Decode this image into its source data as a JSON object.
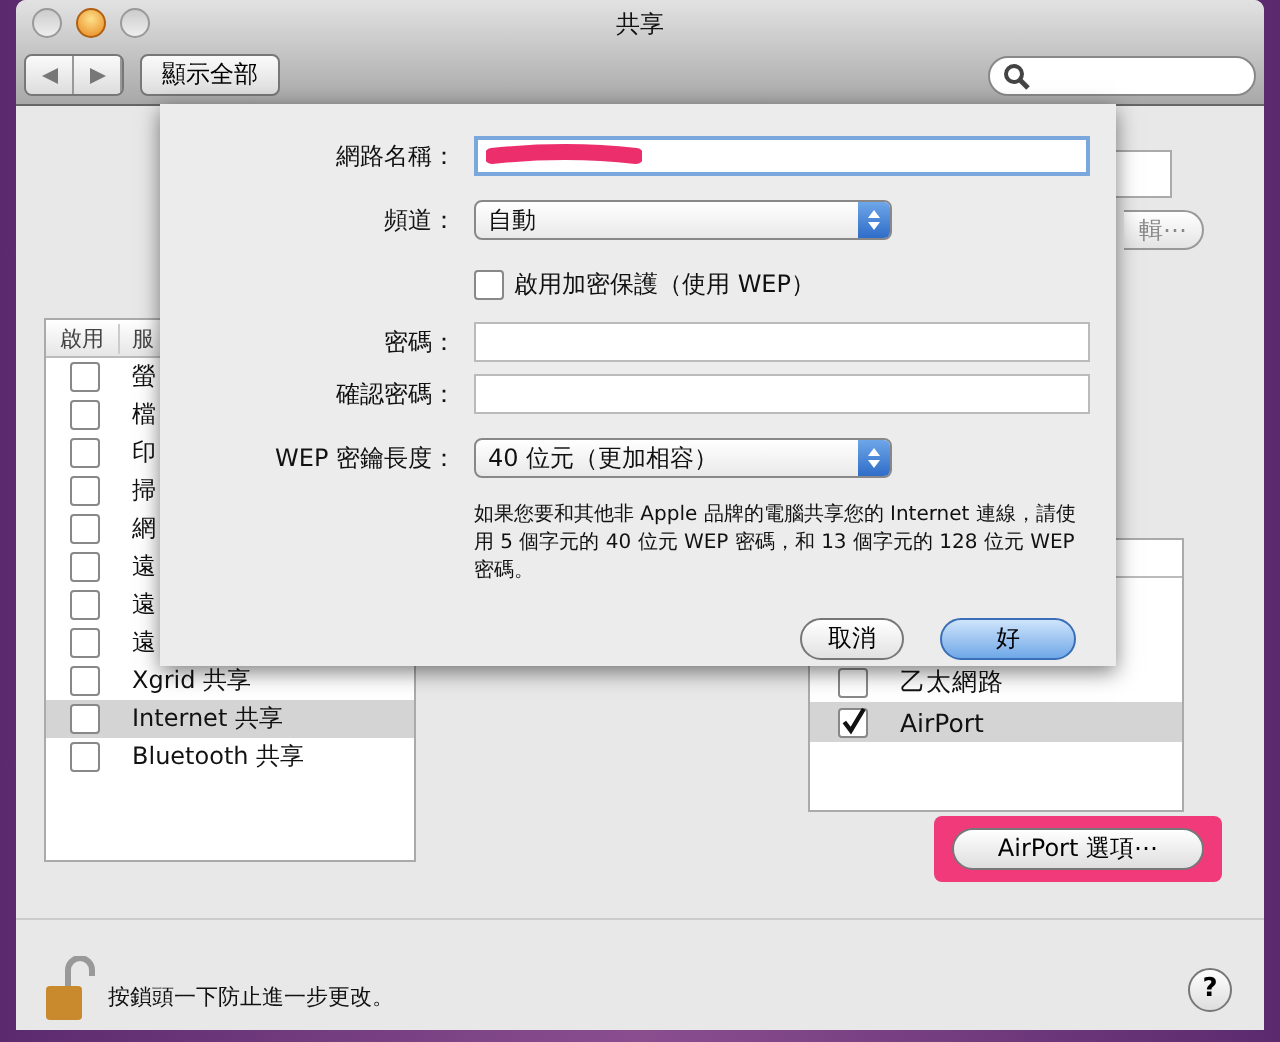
{
  "window": {
    "title": "共享"
  },
  "toolbar": {
    "show_all": "顯示全部"
  },
  "edit_button": "輯⋯",
  "services": {
    "columns": [
      "啟用",
      "服"
    ],
    "items": [
      {
        "name": "螢",
        "checked": false,
        "selected": false
      },
      {
        "name": "檔",
        "checked": false,
        "selected": false
      },
      {
        "name": "印",
        "checked": false,
        "selected": false
      },
      {
        "name": "掃",
        "checked": false,
        "selected": false
      },
      {
        "name": "網",
        "checked": false,
        "selected": false
      },
      {
        "name": "遠",
        "checked": false,
        "selected": false
      },
      {
        "name": "遠",
        "checked": false,
        "selected": false
      },
      {
        "name": "遠",
        "checked": false,
        "selected": false
      },
      {
        "name": "Xgrid 共享",
        "checked": false,
        "selected": false
      },
      {
        "name": "Internet 共享",
        "checked": false,
        "selected": true
      },
      {
        "name": "Bluetooth 共享",
        "checked": false,
        "selected": false
      }
    ]
  },
  "ports": [
    {
      "name": "乙太網路",
      "checked": false,
      "selected": false
    },
    {
      "name": "AirPort",
      "checked": true,
      "selected": true
    }
  ],
  "airport_options": {
    "label": "AirPort 選項⋯",
    "highlighted": true
  },
  "sheet": {
    "network_name": {
      "label": "網路名稱：",
      "redacted": true
    },
    "channel": {
      "label": "頻道：",
      "value": "自動"
    },
    "wep": {
      "label": "啟用加密保護（使用 WEP）",
      "checked": false
    },
    "password": {
      "label": "密碼："
    },
    "confirm": {
      "label": "確認密碼："
    },
    "key_length": {
      "label": "WEP 密鑰長度：",
      "value": "40 位元（更加相容）"
    },
    "note": "如果您要和其他非 Apple 品牌的電腦共享您的 Internet 連線，請使用 5 個字元的 40 位元 WEP 密碼，和 13 個字元的 128 位元 WEP 密碼。",
    "buttons": [
      {
        "label": "取消",
        "default": false
      },
      {
        "label": "好",
        "default": true
      }
    ]
  },
  "footer": {
    "lock_text": "按鎖頭一下防止進一步更改。",
    "help": "?"
  }
}
